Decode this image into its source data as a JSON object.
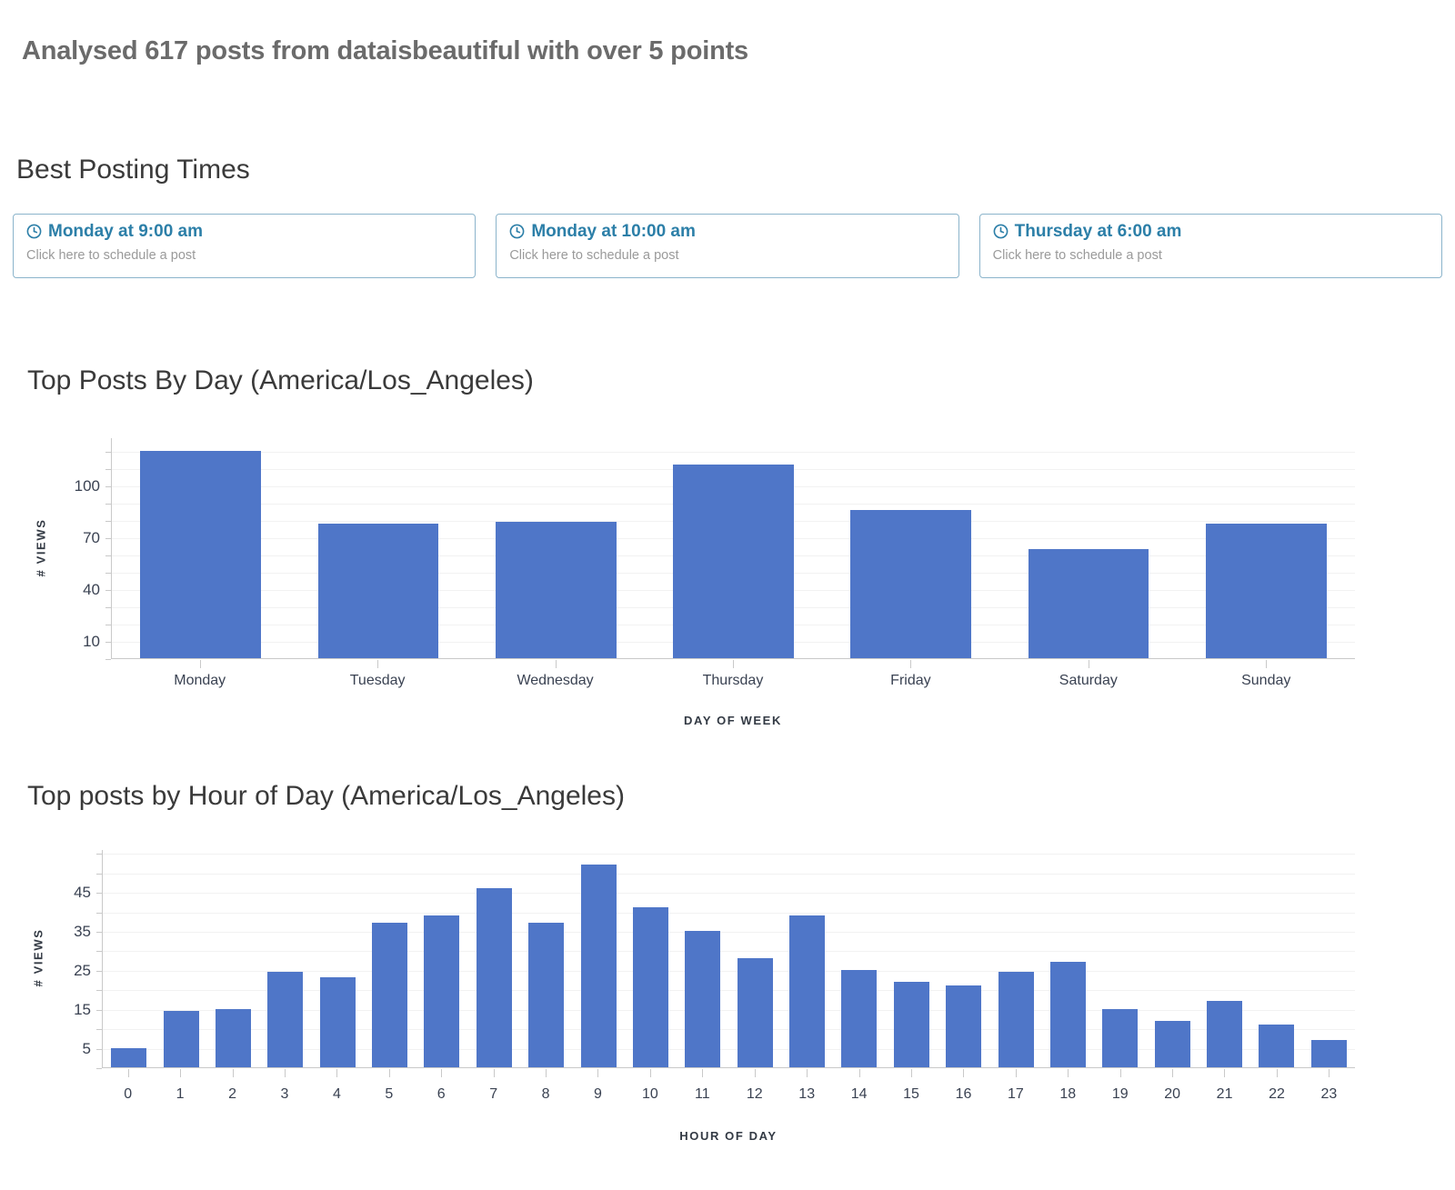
{
  "header": {
    "title": "Analysed 617 posts from dataisbeautiful with over 5 points"
  },
  "best_posting_times": {
    "heading": "Best Posting Times",
    "cards": [
      {
        "time_label": "Monday at 9:00 am",
        "sub_label": "Click here to schedule a post",
        "icon": "clock-icon"
      },
      {
        "time_label": "Monday at 10:00 am",
        "sub_label": "Click here to schedule a post",
        "icon": "clock-icon"
      },
      {
        "time_label": "Thursday at 6:00 am",
        "sub_label": "Click here to schedule a post",
        "icon": "clock-icon"
      }
    ]
  },
  "colors": {
    "bar": "#4f76c8",
    "card_accent": "#2c7fa8",
    "card_border": "#8bb4cb",
    "title_text": "#6b6b6b"
  },
  "chart_data": [
    {
      "type": "bar",
      "title": "Top Posts By Day (America/Los_Angeles)",
      "xlabel": "DAY OF WEEK",
      "ylabel": "# VIEWS",
      "categories": [
        "Monday",
        "Tuesday",
        "Wednesday",
        "Thursday",
        "Friday",
        "Saturday",
        "Sunday"
      ],
      "values": [
        120,
        78,
        79,
        112,
        86,
        63,
        78
      ],
      "ytick_values": [
        10,
        40,
        70,
        100
      ],
      "ylim": [
        0,
        128
      ],
      "grid": true,
      "grid_step": 10,
      "legend": null
    },
    {
      "type": "bar",
      "title": "Top posts by Hour of Day (America/Los_Angeles)",
      "xlabel": "HOUR OF DAY",
      "ylabel": "# VIEWS",
      "categories": [
        "0",
        "1",
        "2",
        "3",
        "4",
        "5",
        "6",
        "7",
        "8",
        "9",
        "10",
        "11",
        "12",
        "13",
        "14",
        "15",
        "16",
        "17",
        "18",
        "19",
        "20",
        "21",
        "22",
        "23"
      ],
      "values": [
        5,
        14.5,
        15,
        24.5,
        23,
        37,
        39,
        46,
        37,
        52,
        41,
        35,
        28,
        39,
        25,
        22,
        21,
        24.5,
        27,
        15,
        12,
        17,
        11,
        7
      ],
      "ytick_values": [
        5,
        15,
        25,
        35,
        45
      ],
      "ylim": [
        0,
        56
      ],
      "grid": true,
      "grid_step": 5,
      "legend": null
    }
  ]
}
